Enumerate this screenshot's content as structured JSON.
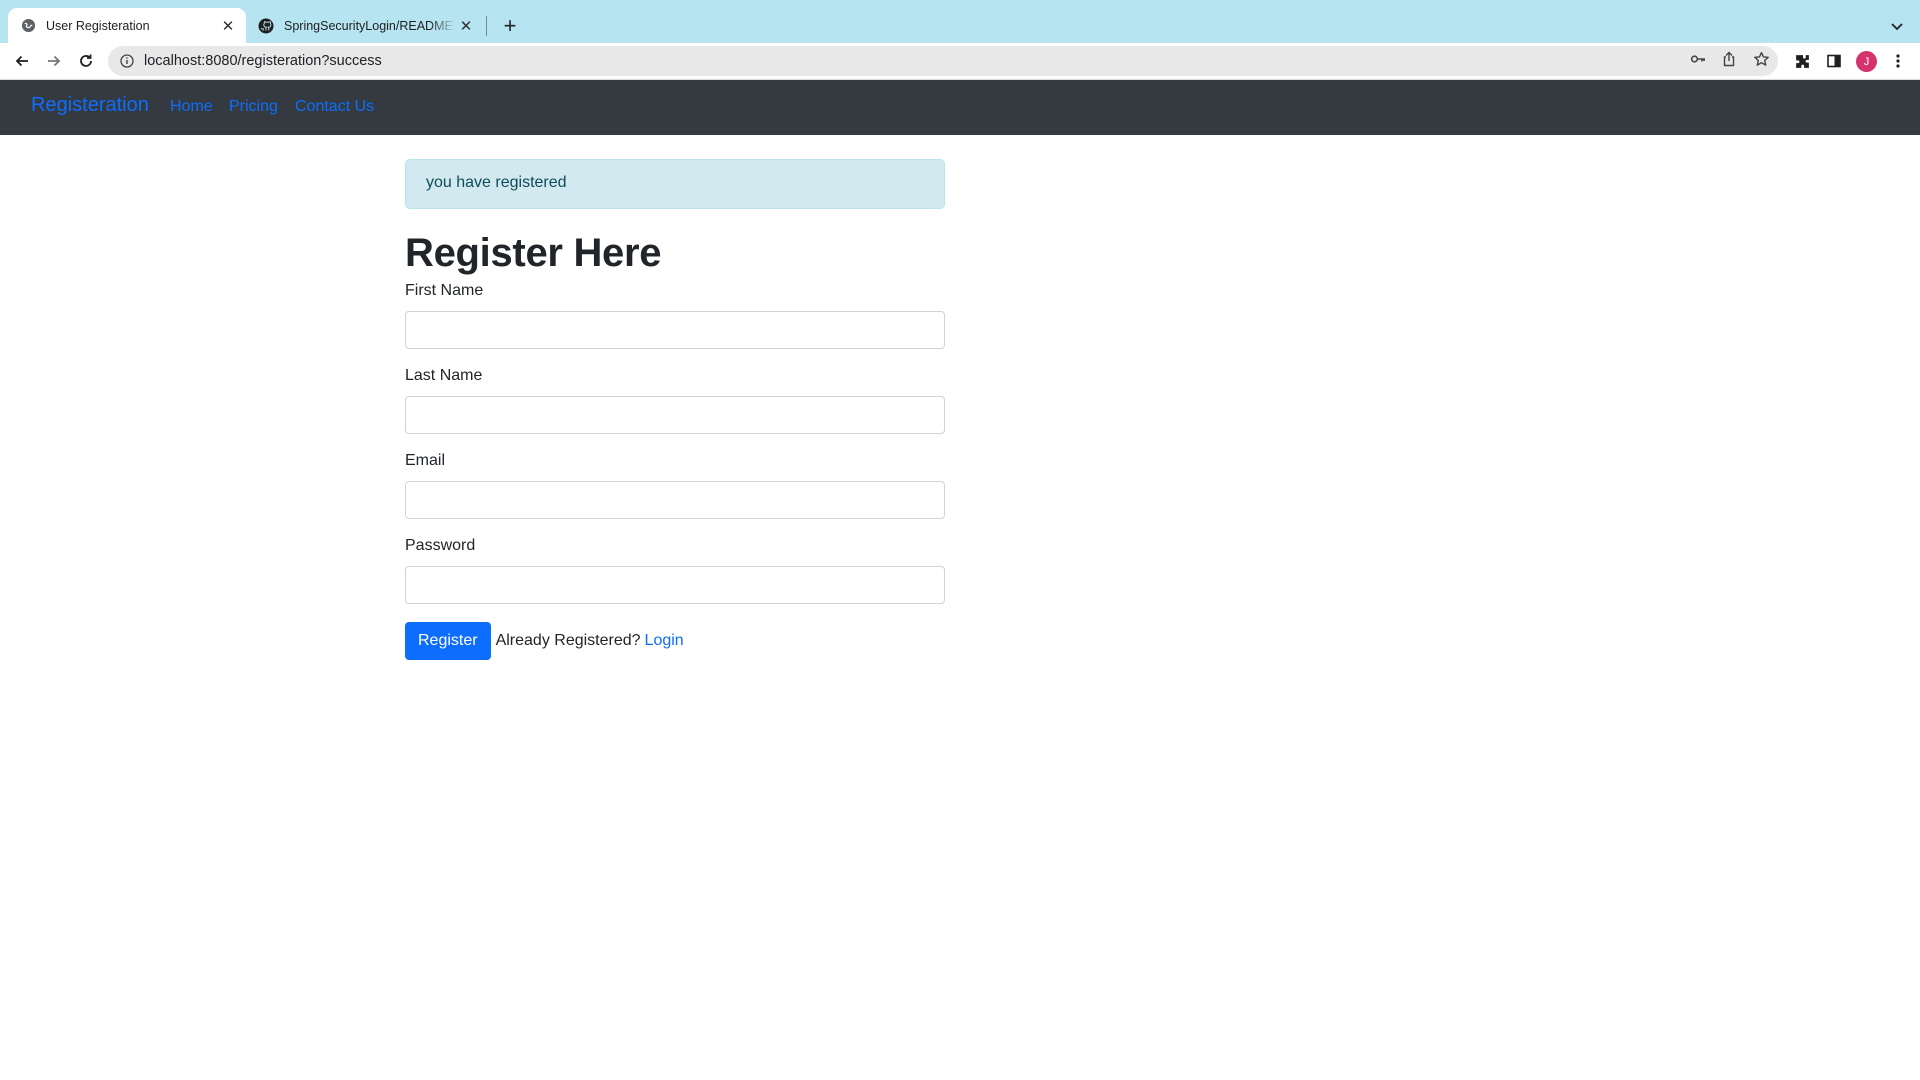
{
  "browser": {
    "tabs": [
      {
        "title": "User Registeration",
        "favicon": "globe-icon",
        "active": true
      },
      {
        "title": "SpringSecurityLogin/README.md",
        "favicon": "github-icon",
        "active": false
      }
    ],
    "new_tab_label": "+",
    "url": "localhost:8080/registeration?success",
    "profile_initial": "J"
  },
  "navbar": {
    "brand": "Registeration",
    "links": [
      {
        "label": "Home"
      },
      {
        "label": "Pricing"
      },
      {
        "label": "Contact Us"
      }
    ]
  },
  "alert": {
    "text": "you have registered"
  },
  "form": {
    "title": "Register Here",
    "fields": [
      {
        "label": "First Name",
        "value": ""
      },
      {
        "label": "Last Name",
        "value": ""
      },
      {
        "label": "Email",
        "value": ""
      },
      {
        "label": "Password",
        "value": ""
      }
    ],
    "submit_label": "Register",
    "already_text": "Already Registered?",
    "login_label": "Login"
  },
  "colors": {
    "tabstrip": "#b6e4f1",
    "navbar": "#343a40",
    "link": "#0d6efd",
    "alert_bg": "#d1e9ef",
    "button": "#0d6efd"
  }
}
